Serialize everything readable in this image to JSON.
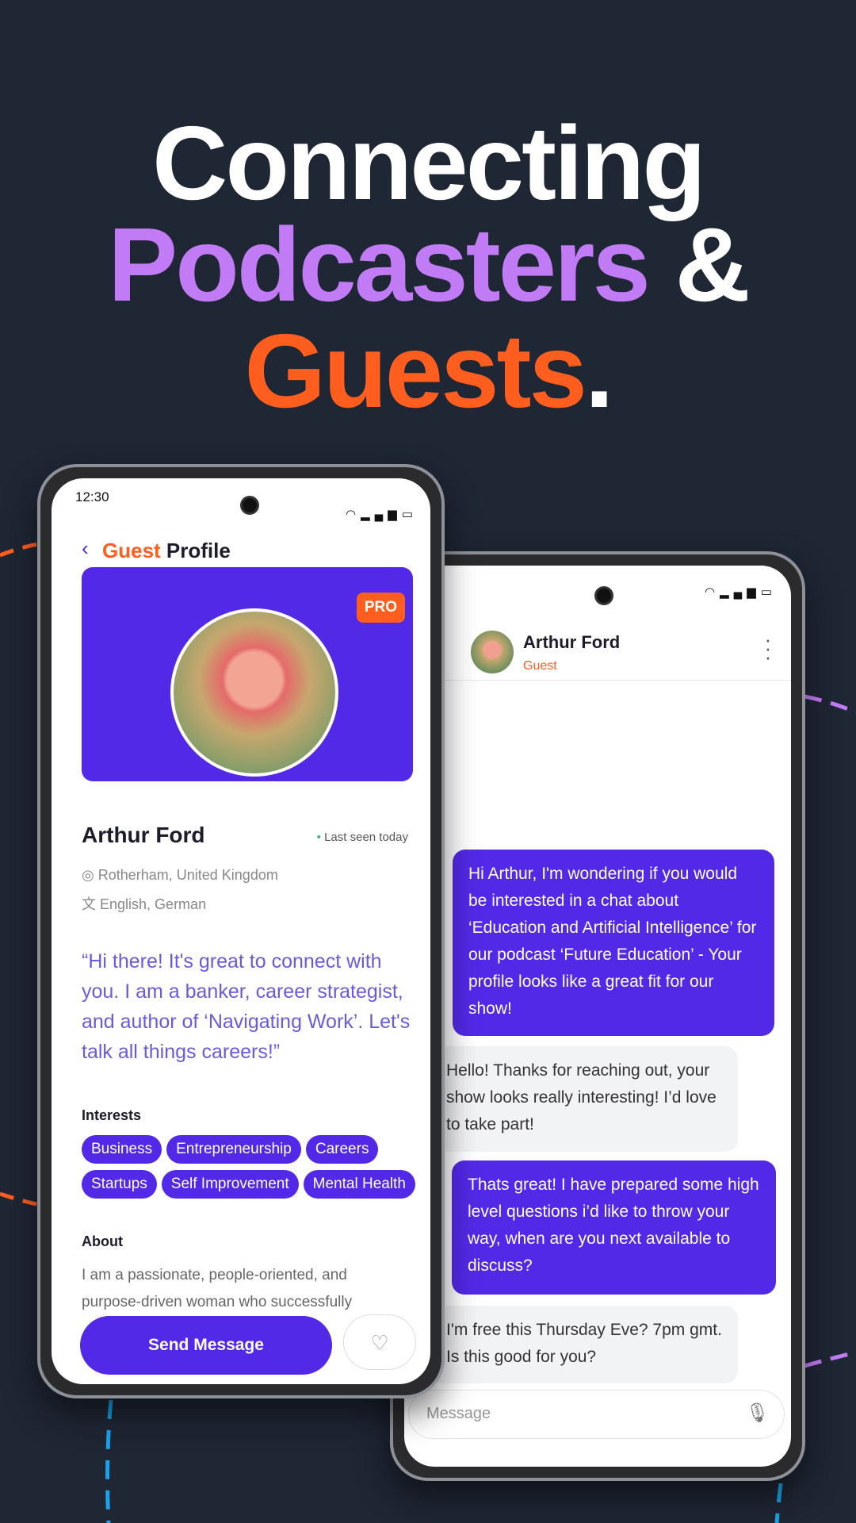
{
  "headline": {
    "line1": "Connecting",
    "line2_a": "Podcasters",
    "line2_b": " &",
    "line3_a": "Guests",
    "line3_b": "."
  },
  "colors": {
    "background": "#1f2634",
    "purple": "#c07bf5",
    "orange": "#ff5e1f",
    "accent": "#5229e6",
    "blue": "#1aa3e8"
  },
  "profile_phone": {
    "status_time": "12:30",
    "status_icons": [
      "wifi-icon",
      "signal-icon",
      "battery-icon"
    ],
    "back_icon": "chevron-left-icon",
    "title_a": "Guest",
    "title_b": " Profile",
    "badge": "PRO",
    "name": "Arthur Ford",
    "last_seen": "Last seen today",
    "location": "Rotherham, United Kingdom",
    "languages": "English, German",
    "quote": "“Hi there! It's great to connect with you. I am a banker, career strategist, and author of ‘Navigating Work’. Let's talk all things careers!”",
    "interests_label": "Interests",
    "interests": [
      "Business",
      "Entrepreneurship",
      "Careers",
      "Startups",
      "Self Improvement",
      "Mental Health"
    ],
    "about_label": "About",
    "about_text": "I am a passionate, people-oriented, and purpose-driven woman who successfully",
    "send_button": "Send Message",
    "favorite_icon": "heart-icon"
  },
  "chat_phone": {
    "contact_name": "Arthur Ford",
    "contact_role": "Guest",
    "menu_icon": "kebab-menu-icon",
    "messages": [
      {
        "from": "me",
        "text": "Hi Arthur, I'm wondering if you would be interested in a chat about ‘Education and Artificial Intelligence’ for our podcast ‘Future Education’ - Your profile looks like a great fit for our show!"
      },
      {
        "from": "guest",
        "text": "Hello! Thanks for reaching out, your show looks really interesting! I’d love to take part!"
      },
      {
        "from": "me",
        "text": "Thats great! I have prepared some high level questions i’d like to throw your way, when are you next available to discuss?"
      },
      {
        "from": "guest",
        "text": "I'm free this Thursday Eve? 7pm gmt. Is this good for you?"
      }
    ],
    "input_placeholder": "Message",
    "mic_icon": "microphone-icon"
  }
}
